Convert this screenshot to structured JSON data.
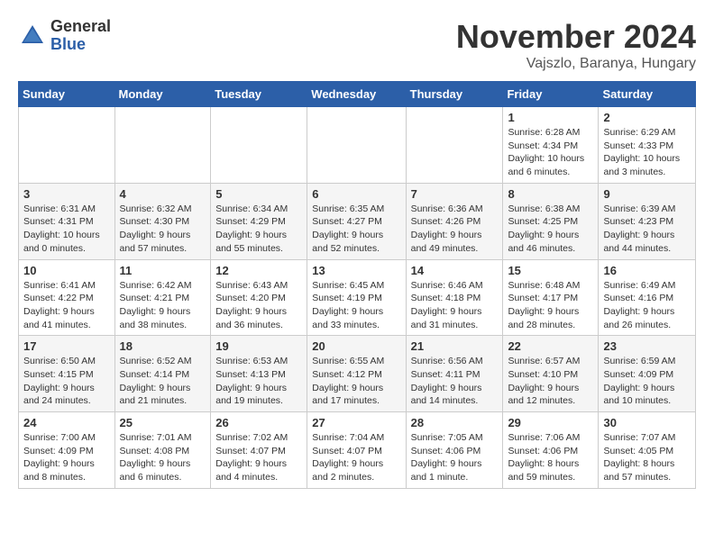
{
  "header": {
    "logo_line1": "General",
    "logo_line2": "Blue",
    "month": "November 2024",
    "location": "Vajszlo, Baranya, Hungary"
  },
  "weekdays": [
    "Sunday",
    "Monday",
    "Tuesday",
    "Wednesday",
    "Thursday",
    "Friday",
    "Saturday"
  ],
  "weeks": [
    [
      {
        "day": "",
        "info": ""
      },
      {
        "day": "",
        "info": ""
      },
      {
        "day": "",
        "info": ""
      },
      {
        "day": "",
        "info": ""
      },
      {
        "day": "",
        "info": ""
      },
      {
        "day": "1",
        "info": "Sunrise: 6:28 AM\nSunset: 4:34 PM\nDaylight: 10 hours\nand 6 minutes."
      },
      {
        "day": "2",
        "info": "Sunrise: 6:29 AM\nSunset: 4:33 PM\nDaylight: 10 hours\nand 3 minutes."
      }
    ],
    [
      {
        "day": "3",
        "info": "Sunrise: 6:31 AM\nSunset: 4:31 PM\nDaylight: 10 hours\nand 0 minutes."
      },
      {
        "day": "4",
        "info": "Sunrise: 6:32 AM\nSunset: 4:30 PM\nDaylight: 9 hours\nand 57 minutes."
      },
      {
        "day": "5",
        "info": "Sunrise: 6:34 AM\nSunset: 4:29 PM\nDaylight: 9 hours\nand 55 minutes."
      },
      {
        "day": "6",
        "info": "Sunrise: 6:35 AM\nSunset: 4:27 PM\nDaylight: 9 hours\nand 52 minutes."
      },
      {
        "day": "7",
        "info": "Sunrise: 6:36 AM\nSunset: 4:26 PM\nDaylight: 9 hours\nand 49 minutes."
      },
      {
        "day": "8",
        "info": "Sunrise: 6:38 AM\nSunset: 4:25 PM\nDaylight: 9 hours\nand 46 minutes."
      },
      {
        "day": "9",
        "info": "Sunrise: 6:39 AM\nSunset: 4:23 PM\nDaylight: 9 hours\nand 44 minutes."
      }
    ],
    [
      {
        "day": "10",
        "info": "Sunrise: 6:41 AM\nSunset: 4:22 PM\nDaylight: 9 hours\nand 41 minutes."
      },
      {
        "day": "11",
        "info": "Sunrise: 6:42 AM\nSunset: 4:21 PM\nDaylight: 9 hours\nand 38 minutes."
      },
      {
        "day": "12",
        "info": "Sunrise: 6:43 AM\nSunset: 4:20 PM\nDaylight: 9 hours\nand 36 minutes."
      },
      {
        "day": "13",
        "info": "Sunrise: 6:45 AM\nSunset: 4:19 PM\nDaylight: 9 hours\nand 33 minutes."
      },
      {
        "day": "14",
        "info": "Sunrise: 6:46 AM\nSunset: 4:18 PM\nDaylight: 9 hours\nand 31 minutes."
      },
      {
        "day": "15",
        "info": "Sunrise: 6:48 AM\nSunset: 4:17 PM\nDaylight: 9 hours\nand 28 minutes."
      },
      {
        "day": "16",
        "info": "Sunrise: 6:49 AM\nSunset: 4:16 PM\nDaylight: 9 hours\nand 26 minutes."
      }
    ],
    [
      {
        "day": "17",
        "info": "Sunrise: 6:50 AM\nSunset: 4:15 PM\nDaylight: 9 hours\nand 24 minutes."
      },
      {
        "day": "18",
        "info": "Sunrise: 6:52 AM\nSunset: 4:14 PM\nDaylight: 9 hours\nand 21 minutes."
      },
      {
        "day": "19",
        "info": "Sunrise: 6:53 AM\nSunset: 4:13 PM\nDaylight: 9 hours\nand 19 minutes."
      },
      {
        "day": "20",
        "info": "Sunrise: 6:55 AM\nSunset: 4:12 PM\nDaylight: 9 hours\nand 17 minutes."
      },
      {
        "day": "21",
        "info": "Sunrise: 6:56 AM\nSunset: 4:11 PM\nDaylight: 9 hours\nand 14 minutes."
      },
      {
        "day": "22",
        "info": "Sunrise: 6:57 AM\nSunset: 4:10 PM\nDaylight: 9 hours\nand 12 minutes."
      },
      {
        "day": "23",
        "info": "Sunrise: 6:59 AM\nSunset: 4:09 PM\nDaylight: 9 hours\nand 10 minutes."
      }
    ],
    [
      {
        "day": "24",
        "info": "Sunrise: 7:00 AM\nSunset: 4:09 PM\nDaylight: 9 hours\nand 8 minutes."
      },
      {
        "day": "25",
        "info": "Sunrise: 7:01 AM\nSunset: 4:08 PM\nDaylight: 9 hours\nand 6 minutes."
      },
      {
        "day": "26",
        "info": "Sunrise: 7:02 AM\nSunset: 4:07 PM\nDaylight: 9 hours\nand 4 minutes."
      },
      {
        "day": "27",
        "info": "Sunrise: 7:04 AM\nSunset: 4:07 PM\nDaylight: 9 hours\nand 2 minutes."
      },
      {
        "day": "28",
        "info": "Sunrise: 7:05 AM\nSunset: 4:06 PM\nDaylight: 9 hours\nand 1 minute."
      },
      {
        "day": "29",
        "info": "Sunrise: 7:06 AM\nSunset: 4:06 PM\nDaylight: 8 hours\nand 59 minutes."
      },
      {
        "day": "30",
        "info": "Sunrise: 7:07 AM\nSunset: 4:05 PM\nDaylight: 8 hours\nand 57 minutes."
      }
    ]
  ]
}
